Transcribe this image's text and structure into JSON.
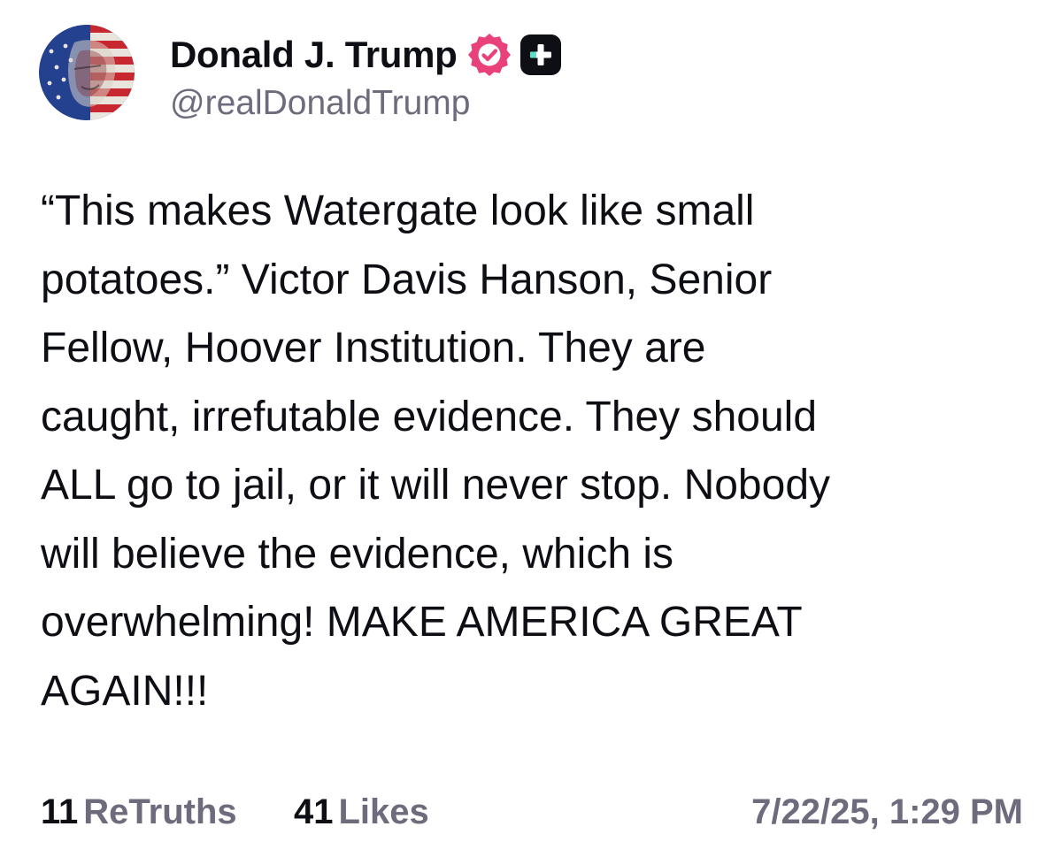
{
  "author": {
    "display_name": "Donald J. Trump",
    "handle": "@realDonaldTrump",
    "verified": true,
    "avatar_icon": "flag-painted-portrait-avatar",
    "verified_icon": "verified-badge-icon",
    "plus_icon": "truth-plus-icon"
  },
  "post": {
    "lines": [
      "“This makes Watergate look like small",
      "potatoes.” Victor Davis Hanson, Senior",
      "Fellow, Hoover Institution. They are",
      "caught, irrefutable evidence. They should",
      "ALL go to jail, or it will never stop. Nobody",
      "will believe the evidence, which is",
      "overwhelming! MAKE AMERICA GREAT",
      "AGAIN!!!"
    ]
  },
  "stats": {
    "retruths_count": "11",
    "retruths_label": "ReTruths",
    "likes_count": "41",
    "likes_label": "Likes",
    "timestamp": "7/22/25, 1:29 PM"
  },
  "colors": {
    "text_primary": "#0d0f14",
    "text_secondary": "#6e6b7d",
    "verified_badge": "#e9417a",
    "plus_badge_bg": "#0d0f14",
    "plus_badge_accent": "#5ee0c8",
    "background": "#ffffff"
  }
}
